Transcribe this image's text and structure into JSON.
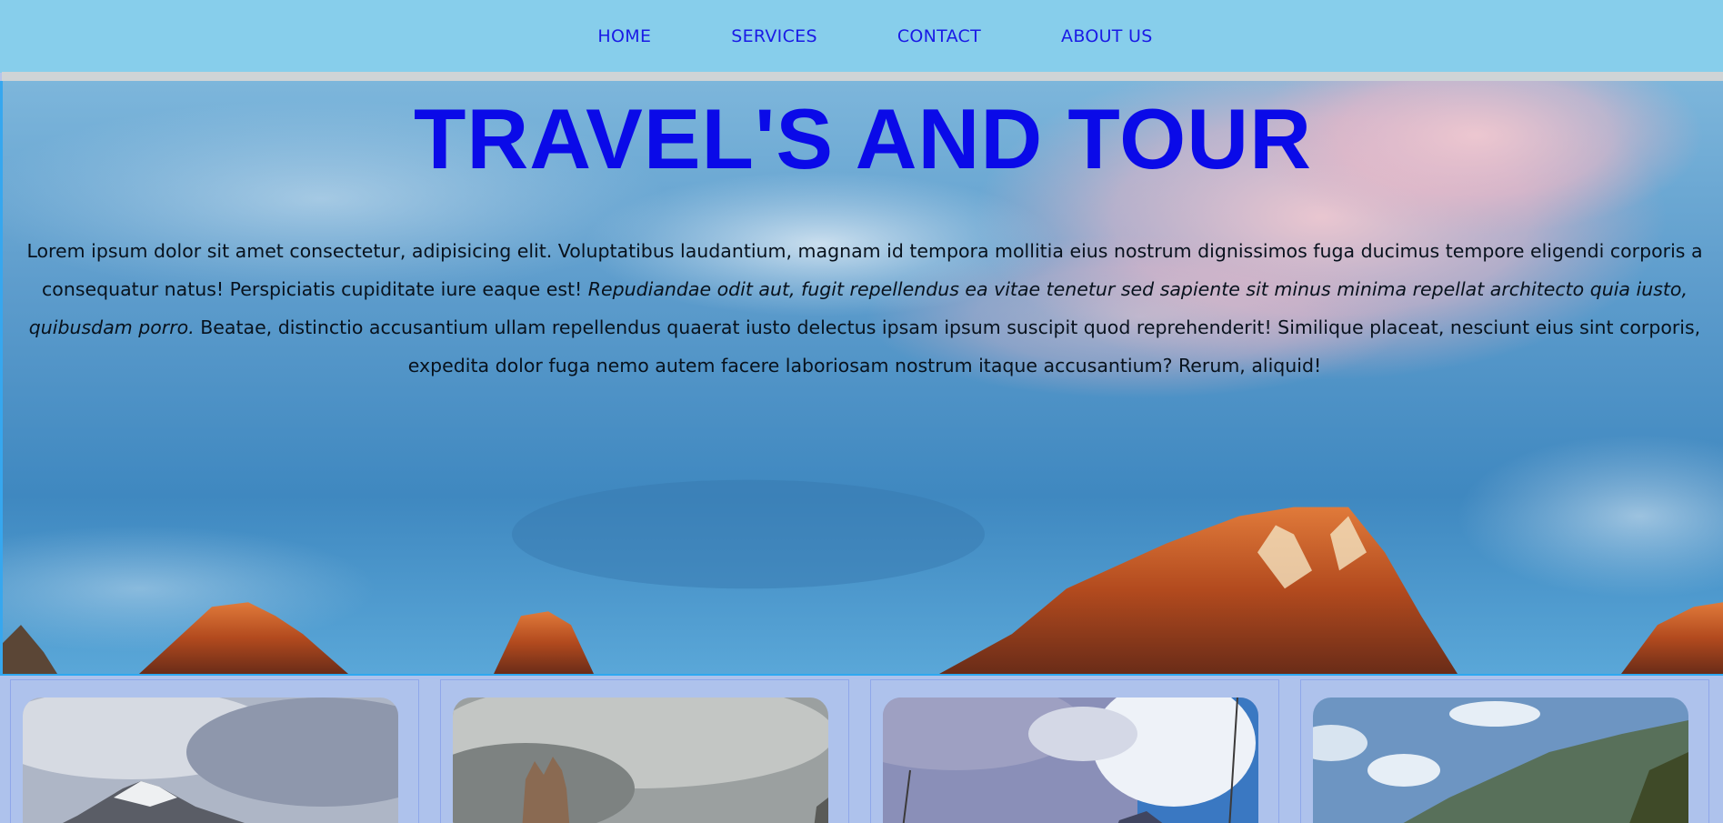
{
  "nav": {
    "items": [
      {
        "label": "HOME"
      },
      {
        "label": "SERVICES"
      },
      {
        "label": "CONTACT"
      },
      {
        "label": "ABOUT US"
      }
    ]
  },
  "hero": {
    "title": "TRAVEL'S AND TOUR",
    "paragraph": {
      "part1": "Lorem ipsum dolor sit amet consectetur, adipisicing elit. Voluptatibus laudantium, magnam id tempora mollitia eius nostrum dignissimos fuga ducimus tempore eligendi corporis a consequatur natus! Perspiciatis cupiditate iure eaque est! ",
      "italic": "Repudiandae odit aut, fugit repellendus ea vitae tenetur sed sapiente sit minus minima repellat architecto quia iusto, quibusdam porro.",
      "part2": " Beatae, distinctio accusantium ullam repellendus quaerat iusto delectus ipsam ipsum suscipit quod reprehenderit! Similique placeat, nesciunt eius sint corporis, expedita dolor fuga nemo autem facere laboriosam nostrum itaque accusantium? Rerum, aliquid!"
    }
  },
  "colors": {
    "nav_bg": "#87ceeb",
    "nav_link": "#1a1ae6",
    "title": "#0a0ae8",
    "cards_bg": "#aec2ec"
  }
}
